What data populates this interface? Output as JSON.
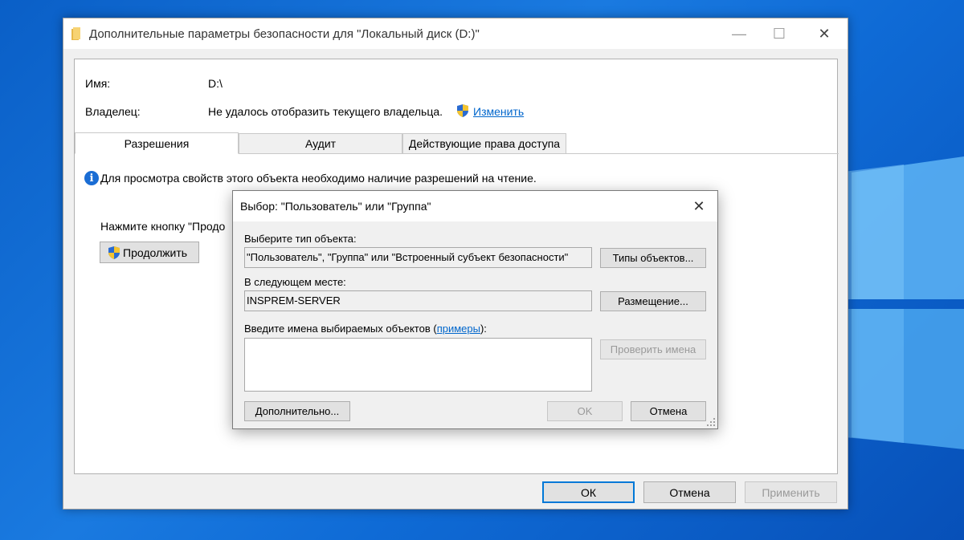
{
  "main_window": {
    "title": "Дополнительные параметры безопасности  для \"Локальный диск (D:)\"",
    "name_label": "Имя:",
    "name_value": "D:\\",
    "owner_label": "Владелец:",
    "owner_value": "Не удалось отобразить текущего владельца.",
    "owner_change_link": "Изменить",
    "tabs": [
      {
        "label": "Разрешения",
        "active": true
      },
      {
        "label": "Аудит",
        "active": false
      },
      {
        "label": "Действующие права доступа",
        "active": false
      }
    ],
    "info_text": "Для просмотра свойств этого объекта необходимо наличие разрешений на чтение.",
    "press_text": "Нажмите кнопку \"Продо",
    "continue_button": "Продолжить",
    "ok_button": "ОК",
    "cancel_button": "Отмена",
    "apply_button": "Применить"
  },
  "dialog": {
    "title": "Выбор: \"Пользователь\" или \"Группа\"",
    "object_type_label": "Выберите тип объекта:",
    "object_type_value": "\"Пользователь\", \"Группа\" или \"Встроенный субъект безопасности\"",
    "object_types_button": "Типы объектов...",
    "location_label": "В следующем месте:",
    "location_value": "INSPREM-SERVER",
    "locations_button": "Размещение...",
    "names_label_prefix": "Введите имена выбираемых объектов (",
    "names_label_link": "примеры",
    "names_label_suffix": "):",
    "names_value": "",
    "check_names_button": "Проверить имена",
    "advanced_button": "Дополнительно...",
    "ok_button": "OK",
    "cancel_button": "Отмена"
  },
  "colors": {
    "desktop": "#1a7ae0",
    "accent": "#0078d7",
    "link": "#0066cc"
  },
  "icons": [
    "folder-icon",
    "shield-icon",
    "info-icon",
    "close-icon",
    "minimize-icon",
    "maximize-icon",
    "resize-grip-icon"
  ]
}
